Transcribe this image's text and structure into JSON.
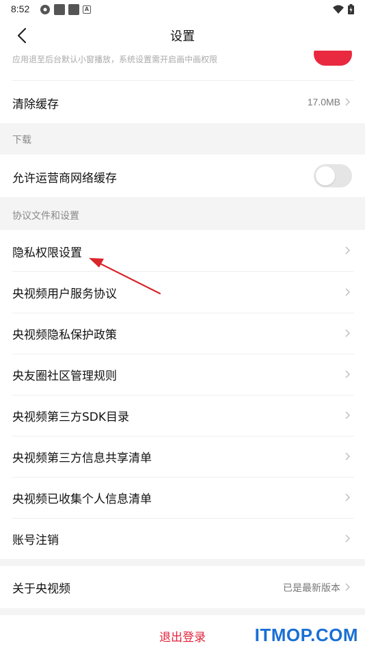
{
  "status_bar": {
    "time": "8:52"
  },
  "header": {
    "title": "设置"
  },
  "pip_row": {
    "hint": "应用退至后台默认小窗播放，系统设置需开启画中画权限",
    "toggle_on": true
  },
  "cache_row": {
    "label": "清除缓存",
    "value": "17.0MB"
  },
  "download_section": {
    "title": "下载"
  },
  "carrier_cache_row": {
    "label": "允许运营商网络缓存",
    "toggle_on": false
  },
  "agreements_section": {
    "title": "协议文件和设置",
    "items": [
      {
        "label": "隐私权限设置"
      },
      {
        "label": "央视频用户服务协议"
      },
      {
        "label": "央视频隐私保护政策"
      },
      {
        "label": "央友圈社区管理规则"
      },
      {
        "label": "央视频第三方SDK目录"
      },
      {
        "label": "央视频第三方信息共享清单"
      },
      {
        "label": "央视频已收集个人信息清单"
      },
      {
        "label": "账号注销"
      }
    ]
  },
  "about_row": {
    "label": "关于央视频",
    "value": "已是最新版本"
  },
  "logout": {
    "label": "退出登录"
  },
  "watermark": {
    "text": "ITMOP.COM"
  },
  "colors": {
    "accent_red": "#e9293f",
    "watermark_blue": "#1a6fd4"
  },
  "icons": [
    "back-arrow-icon",
    "chevron-right-icon",
    "wifi-icon",
    "battery-icon",
    "settings-icon",
    "stop-icon",
    "a-icon"
  ]
}
